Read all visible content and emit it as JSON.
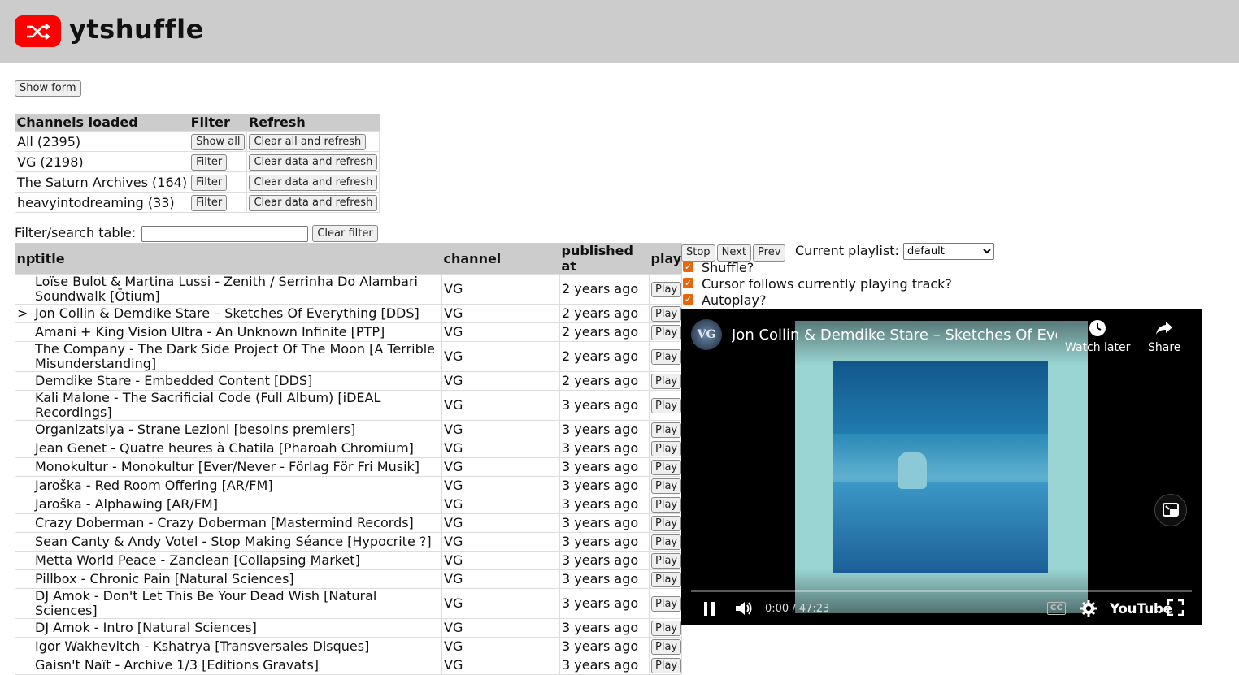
{
  "app": {
    "title": "ytshuffle"
  },
  "form": {
    "show_form_label": "Show form"
  },
  "channels_table": {
    "headers": {
      "channels": "Channels loaded",
      "filter": "Filter",
      "refresh": "Refresh"
    },
    "rows": [
      {
        "name": "All (2395)",
        "filter_label": "Show all",
        "refresh_label": "Clear all and refresh"
      },
      {
        "name": "VG (2198)",
        "filter_label": "Filter",
        "refresh_label": "Clear data and refresh"
      },
      {
        "name": "The Saturn Archives (164)",
        "filter_label": "Filter",
        "refresh_label": "Clear data and refresh"
      },
      {
        "name": "heavyintodreaming (33)",
        "filter_label": "Filter",
        "refresh_label": "Clear data and refresh"
      }
    ]
  },
  "search": {
    "label": "Filter/search table:",
    "value": "",
    "clear_label": "Clear filter"
  },
  "tracks_table": {
    "headers": {
      "np": "np",
      "title": "title",
      "channel": "channel",
      "published": "published at",
      "play": "play"
    },
    "play_label": "Play",
    "rows": [
      {
        "np": "",
        "title": "Loïse Bulot & Martina Lussi - Zenith / Serrinha Do Alambari Soundwalk [Ōtium]",
        "channel": "VG",
        "published": "2 years ago"
      },
      {
        "np": ">",
        "title": "Jon Collin & Demdike Stare – Sketches Of Everything [DDS]",
        "channel": "VG",
        "published": "2 years ago"
      },
      {
        "np": "",
        "title": "Amani + King Vision Ultra - An Unknown Infinite [PTP]",
        "channel": "VG",
        "published": "2 years ago"
      },
      {
        "np": "",
        "title": "The Company - The Dark Side Project Of The Moon [A Terrible Misunderstanding]",
        "channel": "VG",
        "published": "2 years ago"
      },
      {
        "np": "",
        "title": "Demdike Stare - Embedded Content [DDS]",
        "channel": "VG",
        "published": "2 years ago"
      },
      {
        "np": "",
        "title": "Kali Malone - The Sacrificial Code (Full Album) [iDEAL Recordings]",
        "channel": "VG",
        "published": "3 years ago"
      },
      {
        "np": "",
        "title": "Organizatsiya - Strane Lezioni [besoins premiers]",
        "channel": "VG",
        "published": "3 years ago"
      },
      {
        "np": "",
        "title": "Jean Genet - Quatre heures à Chatila [Pharoah Chromium]",
        "channel": "VG",
        "published": "3 years ago"
      },
      {
        "np": "",
        "title": "Monokultur - Monokultur [Ever/Never - Förlag För Fri Musik]",
        "channel": "VG",
        "published": "3 years ago"
      },
      {
        "np": "",
        "title": "Jaroška - Red Room Offering [AR/FM]",
        "channel": "VG",
        "published": "3 years ago"
      },
      {
        "np": "",
        "title": "Jaroška - Alphawing [AR/FM]",
        "channel": "VG",
        "published": "3 years ago"
      },
      {
        "np": "",
        "title": "Crazy Doberman - Crazy Doberman [Mastermind Records]",
        "channel": "VG",
        "published": "3 years ago"
      },
      {
        "np": "",
        "title": "Sean Canty & Andy Votel - Stop Making Séance [Hypocrite ?]",
        "channel": "VG",
        "published": "3 years ago"
      },
      {
        "np": "",
        "title": "Metta World Peace - Zanclean [Collapsing Market]",
        "channel": "VG",
        "published": "3 years ago"
      },
      {
        "np": "",
        "title": "Pillbox - Chronic Pain [Natural Sciences]",
        "channel": "VG",
        "published": "3 years ago"
      },
      {
        "np": "",
        "title": "DJ Amok - Don't Let This Be Your Dead Wish [Natural Sciences]",
        "channel": "VG",
        "published": "3 years ago"
      },
      {
        "np": "",
        "title": "DJ Amok - Intro [Natural Sciences]",
        "channel": "VG",
        "published": "3 years ago"
      },
      {
        "np": "",
        "title": "Igor Wakhevitch - Kshatrya [Transversales Disques]",
        "channel": "VG",
        "published": "3 years ago"
      },
      {
        "np": "",
        "title": "Gaisn't Naït - Archive 1/3 [Editions Gravats]",
        "channel": "VG",
        "published": "3 years ago"
      }
    ]
  },
  "player_controls": {
    "stop_label": "Stop",
    "next_label": "Next",
    "prev_label": "Prev",
    "playlist_label": "Current playlist:",
    "playlist_value": "default",
    "shuffle_label": "Shuffle?",
    "cursor_follows_label": "Cursor follows currently playing track?",
    "autoplay_label": "Autoplay?",
    "shuffle_checked": true,
    "cursor_follows_checked": true,
    "autoplay_checked": true
  },
  "video": {
    "channel_avatar_text": "VG",
    "title": "Jon Collin & Demdike Stare – Sketches Of Everyt...",
    "watch_later_label": "Watch later",
    "share_label": "Share",
    "time": "0:00 / 47:23",
    "cc_label": "CC",
    "brand_label": "YouTube"
  },
  "colors": {
    "header_bg": "#cccccc",
    "logo_red": "#ff0000",
    "checkbox_accent": "#e8660c",
    "table_header_bg": "#cccccc"
  },
  "icons": {
    "logo": "shuffle-icon",
    "pause": "pause-icon",
    "volume": "volume-icon",
    "settings": "gear-icon",
    "fullscreen": "fullscreen-icon",
    "watch_later": "clock-icon",
    "share": "share-icon",
    "pip": "picture-in-picture-icon"
  }
}
